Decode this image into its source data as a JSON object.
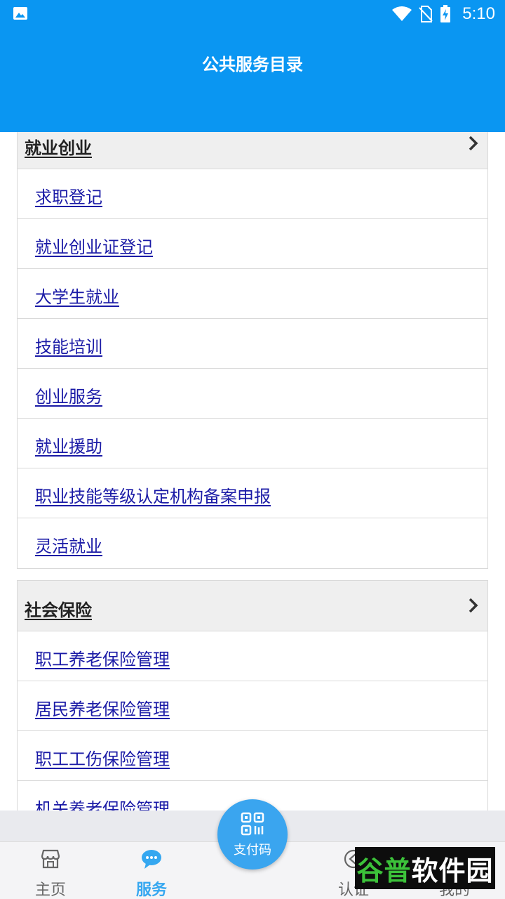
{
  "status_bar": {
    "time": "5:10",
    "icons": [
      "gallery-icon",
      "wifi-icon",
      "no-sim-icon",
      "battery-charging-icon"
    ]
  },
  "header": {
    "title": "公共服务目录"
  },
  "sections": [
    {
      "title": "就业创业",
      "items": [
        "求职登记",
        "就业创业证登记",
        "大学生就业",
        "技能培训",
        "创业服务",
        "就业援助",
        "职业技能等级认定机构备案申报",
        "灵活就业"
      ]
    },
    {
      "title": "社会保险",
      "items": [
        "职工养老保险管理",
        "居民养老保险管理",
        "职工工伤保险管理",
        "机关养老保险管理"
      ]
    }
  ],
  "tabbar": {
    "tabs": [
      {
        "label": "主页",
        "icon": "store-icon",
        "active": false
      },
      {
        "label": "服务",
        "icon": "chat-bubble-icon",
        "active": true
      },
      {
        "label": "认证",
        "icon": "verify-icon",
        "active": false
      },
      {
        "label": "我的",
        "icon": "user-icon",
        "active": false
      }
    ],
    "fab": {
      "label": "支付码",
      "icon": "qr-code-icon"
    }
  },
  "watermark": {
    "part1": "谷普",
    "part2": "软件园"
  },
  "colors": {
    "header": "#0a96f2",
    "link": "#1a1aa6",
    "active_tab": "#35a7f0",
    "fab": "#3aa5ef"
  }
}
